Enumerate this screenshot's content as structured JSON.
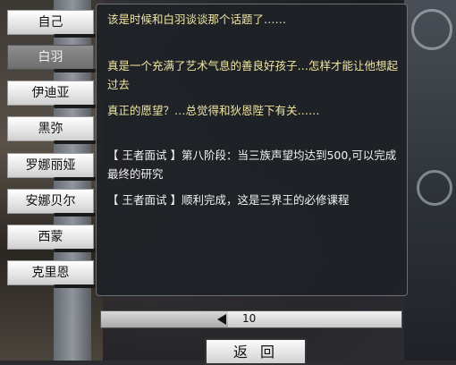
{
  "nav": {
    "items": [
      {
        "label": "自己",
        "selected": false
      },
      {
        "label": "白羽",
        "selected": true
      },
      {
        "label": "伊迪亚",
        "selected": false
      },
      {
        "label": "黑弥",
        "selected": false
      },
      {
        "label": "罗娜丽娅",
        "selected": false
      },
      {
        "label": "安娜贝尔",
        "selected": false
      },
      {
        "label": "西蒙",
        "selected": false
      },
      {
        "label": "克里恩",
        "selected": false
      }
    ]
  },
  "log": {
    "entries": [
      {
        "text": "该是时候和白羽谈谈那个话题了……",
        "color": "yellow"
      },
      {
        "text": "真是一个充满了艺术气息的善良好孩子…怎样才能让他想起过去",
        "color": "yellow"
      },
      {
        "text": "真正的愿望？…总觉得和狄恩陛下有关……",
        "color": "yellow"
      },
      {
        "text": "【 王者面试 】第八阶段：当三族声望均达到500,可以完成最终的研究",
        "color": "white"
      },
      {
        "text": "【 王者面试 】顺利完成，这是三界王的必修课程",
        "color": "white"
      }
    ]
  },
  "pager": {
    "value": "10",
    "arrow_icon": "left-arrow-icon"
  },
  "back_button": {
    "label": "返回"
  },
  "colors": {
    "yellow": "#f0e6a0",
    "white": "#f2f2f2",
    "selected": "#6e6e6e"
  }
}
